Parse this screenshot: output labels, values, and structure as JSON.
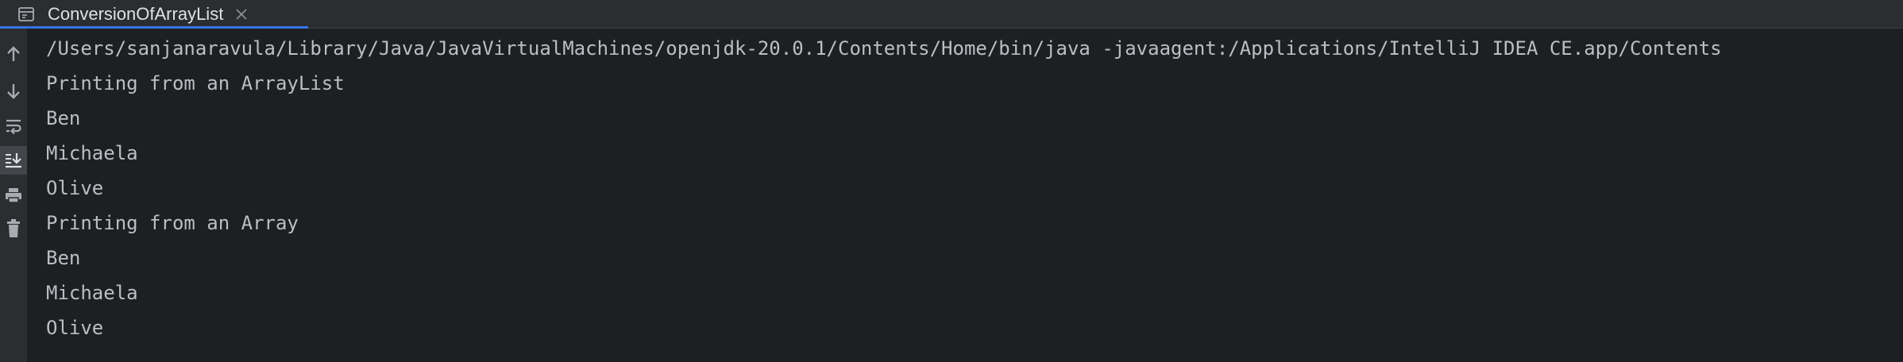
{
  "tab": {
    "title": "ConversionOfArrayList"
  },
  "console": {
    "command": "/Users/sanjanaravula/Library/Java/JavaVirtualMachines/openjdk-20.0.1/Contents/Home/bin/java -javaagent:/Applications/IntelliJ IDEA CE.app/Contents",
    "lines": [
      "Printing from an ArrayList",
      "Ben",
      "Michaela",
      "Olive",
      "Printing from an Array",
      "Ben",
      "Michaela",
      "Olive"
    ]
  },
  "colors": {
    "background": "#1e1f22",
    "panel": "#2b2d30",
    "text": "#bcbec4",
    "accent": "#3574f0",
    "icon": "#a9abb2"
  },
  "icons": {
    "tab": "console-icon",
    "close": "close-icon",
    "toolbar": [
      "up-arrow-icon",
      "down-arrow-icon",
      "soft-wrap-icon",
      "scroll-to-end-icon",
      "print-icon",
      "trash-icon"
    ]
  }
}
